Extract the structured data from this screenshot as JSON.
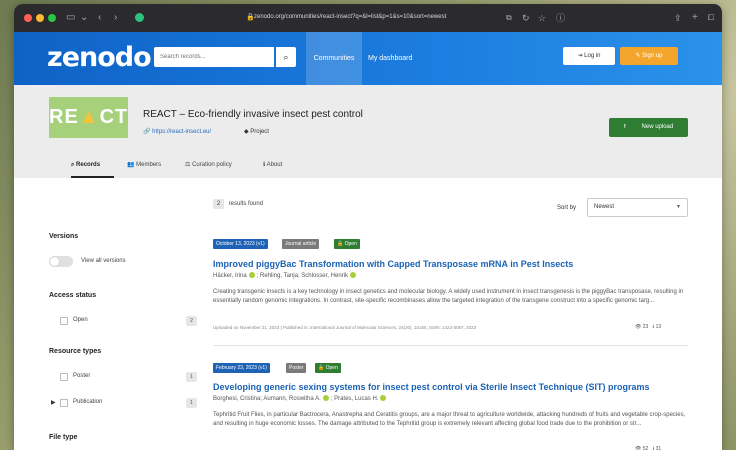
{
  "browser": {
    "url": "zenodo.org/communities/react-insect?q=&l=list&p=1&s=10&sort=newest"
  },
  "header": {
    "logo": "zenodo",
    "search_placeholder": "Search records...",
    "nav_communities": "Communities",
    "nav_dashboard": "My dashboard",
    "login": "Log in",
    "signup": "Sign up"
  },
  "community": {
    "logo_text_left": "RE",
    "logo_text_right": "CT",
    "title": "REACT – Eco-friendly invasive insect pest control",
    "link": "https://react-insect.eu/",
    "type": "Project",
    "new_upload": "New upload",
    "tabs": [
      "Records",
      "Members",
      "Curation policy",
      "About"
    ]
  },
  "results": {
    "count": "2",
    "label": "results found",
    "sort_label": "Sort by",
    "sort_value": "Newest"
  },
  "facets": {
    "versions": {
      "title": "Versions",
      "toggle_label": "View all versions"
    },
    "access_status": {
      "title": "Access status",
      "items": [
        {
          "label": "Open",
          "count": "2"
        }
      ]
    },
    "resource_types": {
      "title": "Resource types",
      "items": [
        {
          "label": "Poster",
          "count": "1"
        },
        {
          "label": "Publication",
          "count": "1"
        }
      ]
    },
    "file_type": {
      "title": "File type"
    }
  },
  "records": [
    {
      "date_badge": "October 13, 2023 (v1)",
      "type_badge": "Journal article",
      "access_badge": "Open",
      "title": "Improved piggyBac Transformation with Capped Transposase mRNA in Pest Insects",
      "authors": [
        "Häcker, Irina",
        "Rehling, Tanja",
        "Schlosser, Henrik"
      ],
      "description": "Creating transgenic insects is a key technology in insect genetics and molecular biology. A widely used instrument in insect transgenesis is the piggyBac transposase, resulting in essentially random genomic integrations. In contrast, site-specific recombinases allow the targeted integration of the transgene construct into a specific genomic targ...",
      "meta": "Uploaded on November 21, 2023 | Published in: International Journal of Molecular Sciences, 24(20), 15155, ISSN: 1422-0067, 2023",
      "views": "23",
      "downloads": "13"
    },
    {
      "date_badge": "February 23, 2023 (v1)",
      "type_badge": "Poster",
      "access_badge": "Open",
      "title": "Developing generic sexing systems for insect pest control via Sterile Insect Technique (SIT) programs",
      "authors": [
        "Borghesi, Cristina",
        "Aumann, Roswitha A.",
        "Prates, Lucas H."
      ],
      "description": "Tephritid Fruit Flies, in particular Bactrocera, Anastrepha and Ceratitis groups, are a major threat to agriculture worldwide, attacking hundreds of fruits and vegetable crop-species, and resulting in huge economic losses. The damage attributed to the Tephritid group is extremely relevant affecting global food trade due to the prohibition or str...",
      "views": "52",
      "downloads": "31"
    }
  ],
  "colors": {
    "header_blue": "#1c7ee0",
    "signup_orange": "#f4a52c",
    "new_upload_green": "#2e7d32",
    "date_badge_blue": "#1e63b5",
    "type_badge_gray": "#7a7a7a",
    "open_badge_green": "#2e7d32",
    "title_link_blue": "#1a63b5"
  },
  "icons": {
    "search": "search-icon",
    "login": "login-icon",
    "signup": "signup-icon",
    "upload": "upload-icon",
    "link": "link-icon",
    "tag": "tag-icon",
    "records": "search-icon",
    "members": "members-icon",
    "curation": "curation-icon",
    "about": "info-icon",
    "views": "eye-icon",
    "downloads": "download-icon"
  }
}
